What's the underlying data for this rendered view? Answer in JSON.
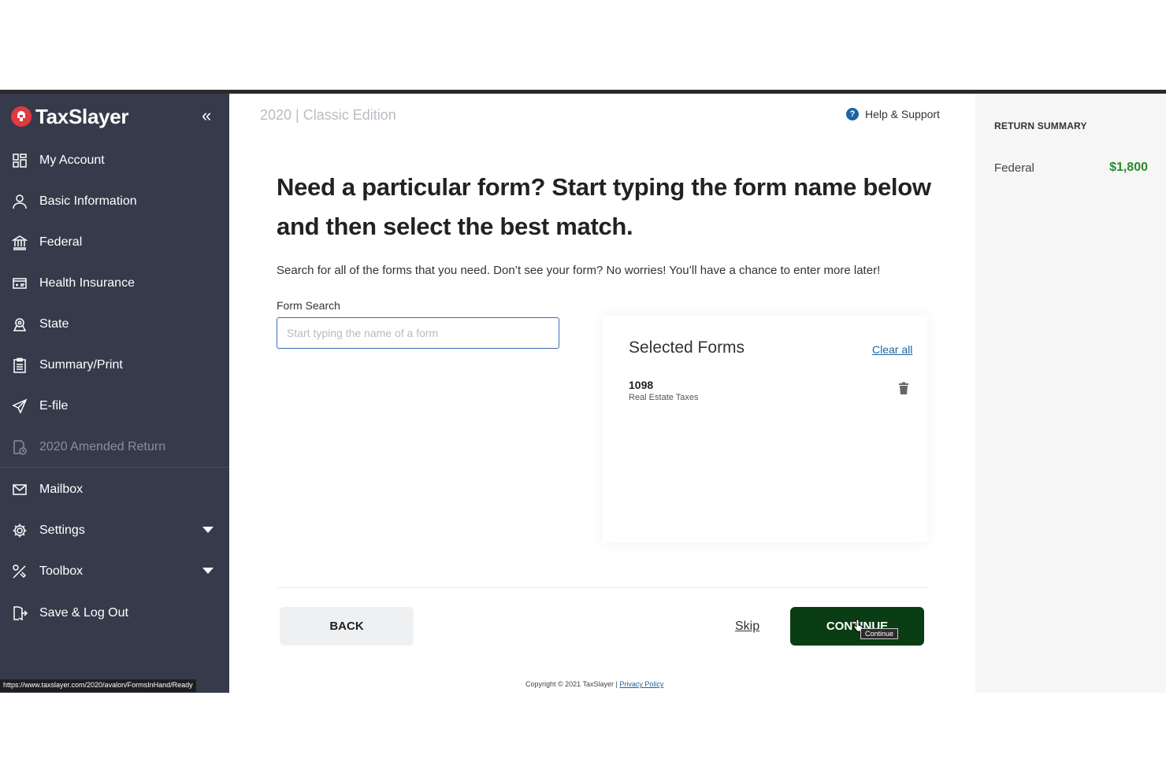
{
  "brand": {
    "name": "TaxSlayer"
  },
  "sidebar": {
    "collapse_glyph": "«",
    "items": [
      {
        "label": "My Account",
        "icon": "dashboard-icon"
      },
      {
        "label": "Basic Information",
        "icon": "user-icon"
      },
      {
        "label": "Federal",
        "icon": "bank-icon"
      },
      {
        "label": "Health Insurance",
        "icon": "health-card-icon"
      },
      {
        "label": "State",
        "icon": "location-icon"
      },
      {
        "label": "Summary/Print",
        "icon": "clipboard-icon"
      },
      {
        "label": "E-file",
        "icon": "send-icon"
      },
      {
        "label": "2020 Amended Return",
        "icon": "amended-doc-icon",
        "disabled": true
      },
      {
        "label": "Mailbox",
        "icon": "mail-icon"
      },
      {
        "label": "Settings",
        "icon": "gear-icon",
        "has_dropdown": true
      },
      {
        "label": "Toolbox",
        "icon": "tools-icon",
        "has_dropdown": true
      },
      {
        "label": "Save & Log Out",
        "icon": "logout-icon"
      }
    ]
  },
  "status_bar": {
    "url": "https://www.taxslayer.com/2020/avalon/FormsInHand/Ready"
  },
  "header": {
    "edition": "2020 | Classic Edition",
    "help_label": "Help & Support"
  },
  "main": {
    "headline": "Need a particular form? Start typing the form name below and then select the best match.",
    "subtext": "Search for all of the forms that you need. Don’t see your form? No worries! You’ll have a chance to enter more later!",
    "form_search_label": "Form Search",
    "search_placeholder": "Start typing the name of a form",
    "search_value": ""
  },
  "selected_forms": {
    "title": "Selected Forms",
    "clear_all": "Clear all",
    "items": [
      {
        "name": "1098",
        "description": "Real Estate Taxes"
      }
    ]
  },
  "actions": {
    "back": "BACK",
    "skip": "Skip",
    "continue": "CONTINUE",
    "tooltip": "Continue"
  },
  "footer": {
    "copyright": "Copyright © 2021 TaxSlayer | ",
    "privacy": "Privacy Policy"
  },
  "return_summary": {
    "title": "RETURN SUMMARY",
    "label": "Federal",
    "value": "$1,800"
  },
  "colors": {
    "sidebar_bg": "#363b4b",
    "brand_red": "#e0393e",
    "continue_green": "#0a3d13",
    "refund_green": "#2a8a2a",
    "link_blue": "#1d63a3"
  }
}
